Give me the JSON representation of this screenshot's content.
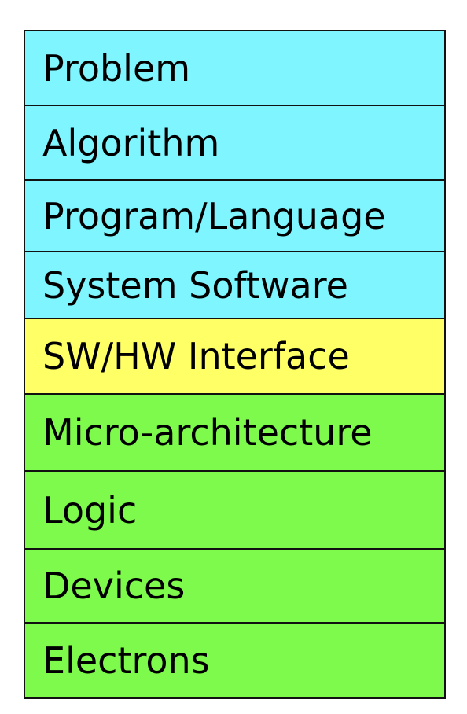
{
  "colors": {
    "software": "#7ff6ff",
    "interface": "#ffff66",
    "hardware": "#7dfa4b",
    "border": "#111111"
  },
  "layers": [
    {
      "label": "Problem",
      "group": "software"
    },
    {
      "label": "Algorithm",
      "group": "software"
    },
    {
      "label": "Program/Language",
      "group": "software"
    },
    {
      "label": "System Software",
      "group": "software"
    },
    {
      "label": "SW/HW Interface",
      "group": "interface"
    },
    {
      "label": "Micro-architecture",
      "group": "hardware"
    },
    {
      "label": "Logic",
      "group": "hardware"
    },
    {
      "label": "Devices",
      "group": "hardware"
    },
    {
      "label": "Electrons",
      "group": "hardware"
    }
  ]
}
